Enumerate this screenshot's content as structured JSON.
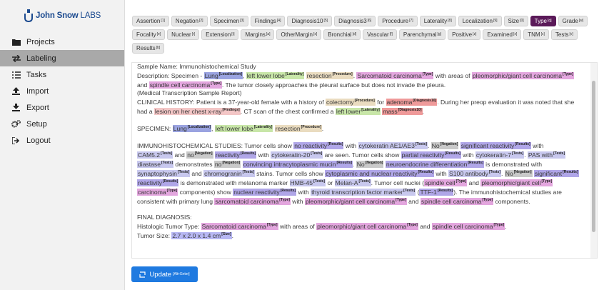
{
  "app": {
    "logo_word": "John Snow",
    "logo_suffix": "LABS",
    "brand_color": "#1b4a8f"
  },
  "sidebar": {
    "items": [
      {
        "label": "Projects",
        "icon": "folder-icon",
        "active": false
      },
      {
        "label": "Labeling",
        "icon": "swap-icon",
        "active": true
      },
      {
        "label": "Tasks",
        "icon": "list-icon",
        "active": false
      },
      {
        "label": "Import",
        "icon": "upload-icon",
        "active": false
      },
      {
        "label": "Export",
        "icon": "download-icon",
        "active": false
      },
      {
        "label": "Setup",
        "icon": "gears-icon",
        "active": false
      },
      {
        "label": "Logout",
        "icon": "logout-icon",
        "active": false
      }
    ]
  },
  "labels": [
    {
      "name": "Assertion",
      "key": "[1]"
    },
    {
      "name": "Negation",
      "key": "[2]"
    },
    {
      "name": "Specimen",
      "key": "[3]"
    },
    {
      "name": "Findings",
      "key": "[4]"
    },
    {
      "name": "Diagnosis10",
      "key": "[5]"
    },
    {
      "name": "Diagnosis3",
      "key": "[6]"
    },
    {
      "name": "Procedure",
      "key": "[7]"
    },
    {
      "name": "Laterality",
      "key": "[8]"
    },
    {
      "name": "Localization",
      "key": "[9]"
    },
    {
      "name": "Size",
      "key": "[0]"
    },
    {
      "name": "Type",
      "key": "[q]",
      "active": true
    },
    {
      "name": "Grade",
      "key": "[w]"
    },
    {
      "name": "Focality",
      "key": "[e]"
    },
    {
      "name": "Nuclear",
      "key": "[r]"
    },
    {
      "name": "Extension",
      "key": "[t]"
    },
    {
      "name": "Margins",
      "key": "[a]"
    },
    {
      "name": "OtherMargin",
      "key": "[s]"
    },
    {
      "name": "Bronchial",
      "key": "[d]"
    },
    {
      "name": "Vascular",
      "key": "[f]"
    },
    {
      "name": "Parenchymal",
      "key": "[g]"
    },
    {
      "name": "Positive",
      "key": "[z]"
    },
    {
      "name": "Examined",
      "key": "[x]"
    },
    {
      "name": "TNM",
      "key": "[c]"
    },
    {
      "name": "Tests",
      "key": "[v]"
    },
    {
      "name": "Results",
      "key": "[b]"
    }
  ],
  "colors": {
    "Localization": "#9aa3e0",
    "Laterality": "#c8e6a8",
    "Procedure": "#eadcc0",
    "Type": "#e3a6de",
    "Findings": "#f3c6c6",
    "Diagnosis10": "#ef9a9a",
    "Results": "#b0a6e8",
    "Tests": "#c8c8ee",
    "Negation": "#c9c9c9",
    "Size": "#b7b7f3"
  },
  "document": {
    "lines": [
      [
        {
          "t": "Sample Name: Immunohistochemical Study"
        }
      ],
      [
        {
          "t": "Description: Specimen - "
        },
        {
          "t": "Lung",
          "l": "Localization"
        },
        {
          "t": ", "
        },
        {
          "t": "left lower lobe",
          "l": "Laterality"
        },
        {
          "t": " "
        },
        {
          "t": "resection",
          "l": "Procedure"
        },
        {
          "t": ". "
        },
        {
          "t": "Sarcomatoid carcinoma",
          "l": "Type"
        },
        {
          "t": " with areas of "
        },
        {
          "t": "pleomorphic/giant cell carcinoma",
          "l": "Type"
        }
      ],
      [
        {
          "t": "and "
        },
        {
          "t": "spindle cell carcinoma",
          "l": "Type"
        },
        {
          "t": ". The tumor closely approaches the pleural surface but does not invade the pleura."
        }
      ],
      [
        {
          "t": "(Medical Transcription Sample Report)"
        }
      ],
      [
        {
          "t": "CLINICAL HISTORY: Patient is a 37-year-old female with a history of "
        },
        {
          "t": "colectomy",
          "l": "Procedure"
        },
        {
          "t": " for "
        },
        {
          "t": "adenoma",
          "l": "Diagnosis10"
        },
        {
          "t": ". During her preop evaluation it was noted that she"
        }
      ],
      [
        {
          "t": "had a "
        },
        {
          "t": "lesion on her chest x-ray",
          "l": "Findings"
        },
        {
          "t": ". CT scan of the chest confirmed a "
        },
        {
          "t": "left lower",
          "l": "Laterality"
        },
        {
          "t": " "
        },
        {
          "t": "mass",
          "l": "Diagnosis10"
        },
        {
          "t": "."
        }
      ],
      [],
      [
        {
          "t": "SPECIMEN: "
        },
        {
          "t": "Lung",
          "l": "Localization"
        },
        {
          "t": ", "
        },
        {
          "t": "left lower lobe",
          "l": "Laterality"
        },
        {
          "t": " "
        },
        {
          "t": "resection",
          "l": "Procedure"
        },
        {
          "t": "."
        }
      ],
      [],
      [
        {
          "t": "IMMUNOHISTOCHEMICAL STUDIES: Tumor cells show "
        },
        {
          "t": "no reactivity",
          "l": "Results"
        },
        {
          "t": " with "
        },
        {
          "t": "cytokeratin AE1/AE3",
          "l": "Tests"
        },
        {
          "t": ". "
        },
        {
          "t": "No",
          "l": "Negation"
        },
        {
          "t": " "
        },
        {
          "t": "significant reactivity",
          "l": "Results"
        },
        {
          "t": " with"
        }
      ],
      [
        {
          "t": "CAM5.2",
          "l": "Tests"
        },
        {
          "t": " and "
        },
        {
          "t": "no",
          "l": "Negation"
        },
        {
          "t": " "
        },
        {
          "t": "reactivity",
          "l": "Results"
        },
        {
          "t": " with "
        },
        {
          "t": "cytokeratin-20",
          "l": "Tests"
        },
        {
          "t": " are seen. Tumor cells show "
        },
        {
          "t": "partial reactivity",
          "l": "Results"
        },
        {
          "t": " with "
        },
        {
          "t": "cytokeratin-7",
          "l": "Tests"
        },
        {
          "t": ". "
        },
        {
          "t": "PAS with",
          "l": "Tests"
        }
      ],
      [
        {
          "t": "diastase",
          "l": "Tests"
        },
        {
          "t": " demonstrates "
        },
        {
          "t": "no",
          "l": "Negation"
        },
        {
          "t": " "
        },
        {
          "t": "convincing intracytoplasmic mucin",
          "l": "Results"
        },
        {
          "t": ". "
        },
        {
          "t": "No",
          "l": "Negation"
        },
        {
          "t": " "
        },
        {
          "t": "neuroendocrine differentiation",
          "l": "Results"
        },
        {
          "t": " is demonstrated with"
        }
      ],
      [
        {
          "t": "synaptophysin",
          "l": "Tests"
        },
        {
          "t": " and "
        },
        {
          "t": "chromogranin",
          "l": "Tests"
        },
        {
          "t": " stains. Tumor cells show "
        },
        {
          "t": "cytoplasmic and nuclear reactivity",
          "l": "Results"
        },
        {
          "t": " with "
        },
        {
          "t": "S100 antibody",
          "l": "Tests"
        },
        {
          "t": ". "
        },
        {
          "t": "No",
          "l": "Negation"
        },
        {
          "t": " "
        },
        {
          "t": "significant",
          "l": "Results"
        }
      ],
      [
        {
          "t": "reactivity",
          "l": "Results"
        },
        {
          "t": " is demonstrated with melanoma marker "
        },
        {
          "t": "HMB-45",
          "l": "Tests"
        },
        {
          "t": " or "
        },
        {
          "t": "Melan-A",
          "l": "Tests"
        },
        {
          "t": ". Tumor cell nuclei ("
        },
        {
          "t": "spindle cell",
          "l": "Type"
        },
        {
          "t": " and "
        },
        {
          "t": "pleomorphic/giant cell",
          "l": "Type"
        }
      ],
      [
        {
          "t": "carcinoma",
          "l": "Type"
        },
        {
          "t": " components) show "
        },
        {
          "t": "nuclear reactivity",
          "l": "Results"
        },
        {
          "t": " with "
        },
        {
          "t": "thyroid transcription factor marker",
          "l": "Tests"
        },
        {
          "t": " ("
        },
        {
          "t": "TTF-1",
          "l": "Results"
        },
        {
          "t": "). The immunohistochemical studies are"
        }
      ],
      [
        {
          "t": "consistent with primary lung "
        },
        {
          "t": "sarcomatoid carcinoma",
          "l": "Type"
        },
        {
          "t": " with "
        },
        {
          "t": "pleomorphic/giant cell carcinoma",
          "l": "Type"
        },
        {
          "t": " and "
        },
        {
          "t": "spindle cell carcinoma",
          "l": "Type"
        },
        {
          "t": " components."
        }
      ],
      [],
      [
        {
          "t": "FINAL DIAGNOSIS:"
        }
      ],
      [
        {
          "t": "Histologic Tumor Type: "
        },
        {
          "t": "Sarcomatoid carcinoma",
          "l": "Type"
        },
        {
          "t": " with areas of "
        },
        {
          "t": "pleomorphic/giant cell carcinoma",
          "l": "Type"
        },
        {
          "t": " and "
        },
        {
          "t": "spindle cell carcinoma",
          "l": "Type"
        },
        {
          "t": "."
        }
      ],
      [
        {
          "t": "Tumor Size: "
        },
        {
          "t": "2.7 x 2.0 x 1.4 cm",
          "l": "Size"
        },
        {
          "t": "."
        }
      ]
    ]
  },
  "footer": {
    "update_label": "Update",
    "update_shortcut": "[Alt+Enter]"
  }
}
